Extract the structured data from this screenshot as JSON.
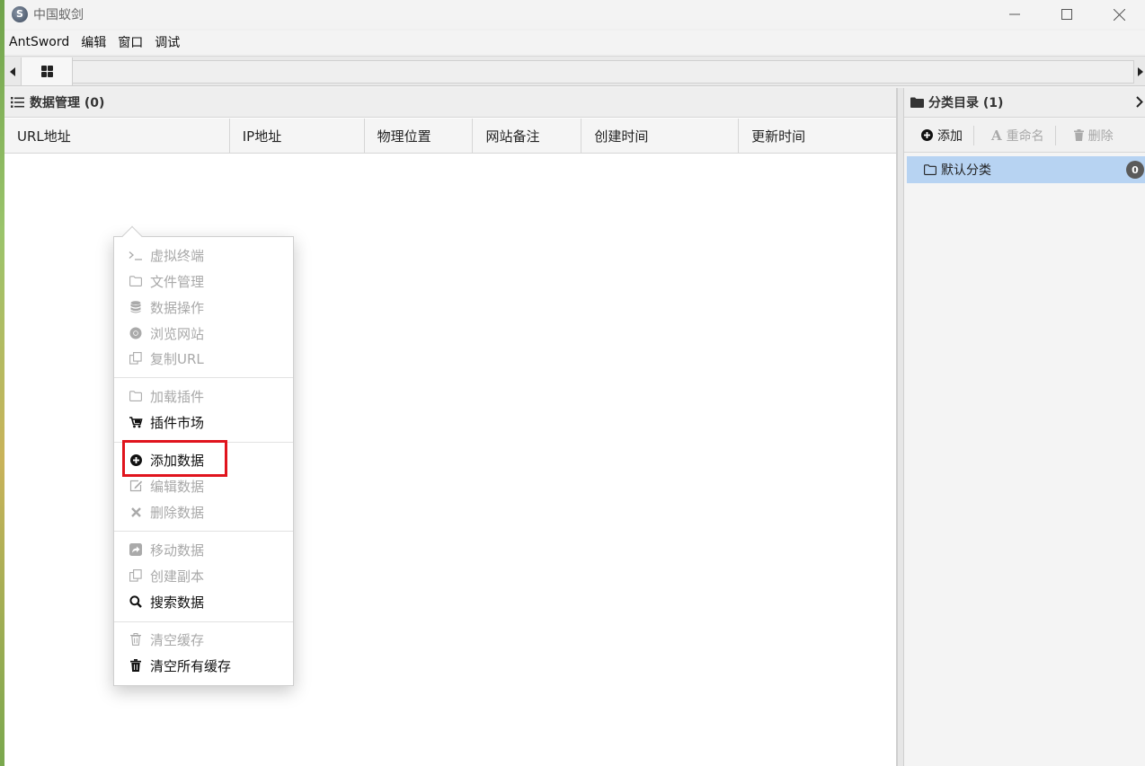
{
  "window": {
    "title": "中国蚁剑",
    "app_icon_glyph": "S"
  },
  "menubar": {
    "items": [
      "AntSword",
      "编辑",
      "窗口",
      "调试"
    ]
  },
  "data_panel": {
    "title": "数据管理 (0)",
    "columns": [
      "URL地址",
      "IP地址",
      "物理位置",
      "网站备注",
      "创建时间",
      "更新时间"
    ]
  },
  "category_panel": {
    "title": "分类目录 (1)",
    "toolbar": {
      "add_label": "添加",
      "rename_label": "重命名",
      "delete_label": "删除"
    },
    "items": [
      {
        "label": "默认分类",
        "count": "0"
      }
    ]
  },
  "context_menu": {
    "items": [
      {
        "label": "虚拟终端",
        "icon": "terminal-icon",
        "enabled": false
      },
      {
        "label": "文件管理",
        "icon": "folder-icon",
        "enabled": false
      },
      {
        "label": "数据操作",
        "icon": "database-icon",
        "enabled": false
      },
      {
        "label": "浏览网站",
        "icon": "chrome-icon",
        "enabled": false
      },
      {
        "label": "复制URL",
        "icon": "copy-icon",
        "enabled": false
      },
      {
        "label": "加载插件",
        "icon": "folder-icon",
        "enabled": false
      },
      {
        "label": "插件市场",
        "icon": "cart-icon",
        "enabled": true
      },
      {
        "label": "添加数据",
        "icon": "plus-circle-icon",
        "enabled": true,
        "highlighted": true
      },
      {
        "label": "编辑数据",
        "icon": "edit-icon",
        "enabled": false
      },
      {
        "label": "删除数据",
        "icon": "x-icon",
        "enabled": false
      },
      {
        "label": "移动数据",
        "icon": "share-icon",
        "enabled": false
      },
      {
        "label": "创建副本",
        "icon": "copy-icon",
        "enabled": false
      },
      {
        "label": "搜索数据",
        "icon": "search-icon",
        "enabled": true
      },
      {
        "label": "清空缓存",
        "icon": "trash-outline-icon",
        "enabled": false
      },
      {
        "label": "清空所有缓存",
        "icon": "trash-icon",
        "enabled": true
      }
    ]
  },
  "colors": {
    "selected_row": "#b7d3f2",
    "highlight_border": "#e0141d",
    "disabled_text": "#a9a9a9"
  }
}
